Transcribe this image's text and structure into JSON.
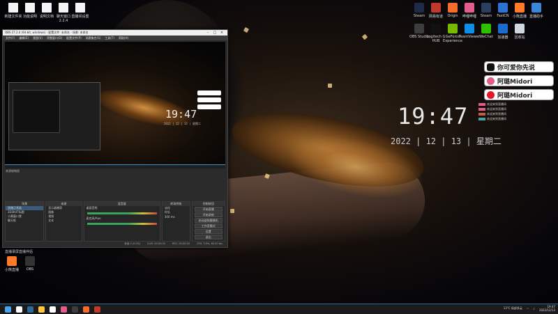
{
  "colors": {
    "accent": "#2d6a99",
    "obs_selected": "#3a5a7a",
    "meter_green": "#3ca55c"
  },
  "desktop": {
    "top_left_icons": [
      {
        "label": "新建文件夹",
        "kind": "file"
      },
      {
        "label": "功能说明",
        "kind": "file"
      },
      {
        "label": "说明文档",
        "kind": "file"
      },
      {
        "label": "聊天窗口 2.2.4",
        "kind": "file"
      },
      {
        "label": "直播间设置",
        "kind": "file"
      }
    ],
    "top_right_icons": [
      {
        "label": "Steam",
        "color": "#1e2a48"
      },
      {
        "label": "网易有道",
        "color": "#c0392b"
      },
      {
        "label": "Origin",
        "color": "#f56c2d"
      },
      {
        "label": "哔哩哔哩",
        "color": "#e35d8b"
      },
      {
        "label": "Steam",
        "color": "#2a3f5f"
      },
      {
        "label": "FastCN",
        "color": "#2b74d6"
      },
      {
        "label": "小熊直播",
        "color": "#ff7a29"
      },
      {
        "label": "直播助手",
        "color": "#3a86d8"
      },
      {
        "label": "OBS Studio",
        "color": "#3d3d3d"
      },
      {
        "label": "Logitech G HUB",
        "color": "#111111"
      },
      {
        "label": "GeForce Experience",
        "color": "#76b900"
      },
      {
        "label": "TeamViewer",
        "color": "#0e8ee9"
      },
      {
        "label": "WeChat",
        "color": "#2dc100"
      },
      {
        "label": "加速器",
        "color": "#1b6bd1"
      },
      {
        "label": "回收站",
        "color": "#cfd8e0"
      }
    ],
    "bottom_left_icons": [
      {
        "label": "小熊直播",
        "color": "#ff7a29"
      },
      {
        "label": "OBS",
        "color": "#333333"
      }
    ],
    "mid_left_icons": [
      {
        "label": "直播录屏",
        "color": "#222222"
      },
      {
        "label": "直播伴侣",
        "color": "#222222"
      }
    ]
  },
  "clock_widget": {
    "time": "19:47",
    "date": "2022 | 12 | 13 | 星期二"
  },
  "social_buttons": [
    {
      "label": "你可爱你先说",
      "platform": "tiktok-icon",
      "color": "#111111"
    },
    {
      "label": "阿璐Midori",
      "platform": "bilibili-icon",
      "color": "#e35d8b"
    },
    {
      "label": "阿璐Midori",
      "platform": "weibo-icon",
      "color": "#e6162d"
    }
  ],
  "chat": {
    "lines": [
      "欢迎来到直播间",
      "欢迎来到直播间",
      "欢迎来到直播间",
      "欢迎来到直播间"
    ]
  },
  "obs": {
    "title": "OBS 27.2.4 (64-bit, windows) - 配置文件: 未命名 - 场景: 未命名",
    "menu": [
      "文件(F)",
      "编辑(E)",
      "视图(V)",
      "停靠窗口(D)",
      "配置文件(P)",
      "场景集合(S)",
      "工具(T)",
      "帮助(H)"
    ],
    "preview": {
      "time": "19:47",
      "date": "2022 | 12 | 13 | 星期二"
    },
    "preview_label": "来源缩略图",
    "docks": {
      "scenes": {
        "header": "场景",
        "items": [
          "直播正常画",
          "2D3K4T标题",
          "小黄窗口素",
          "聊天框"
        ]
      },
      "sources": {
        "header": "来源",
        "items": [
          "显示器捕获",
          "图像",
          "视频",
          "文本"
        ]
      },
      "mixer": {
        "header": "混音器",
        "channels": [
          "桌面音频",
          "麦克风/Aux"
        ]
      },
      "transitions": {
        "header": "转场特效",
        "type": "淡化",
        "duration_label": "时长",
        "duration": "300 ms"
      },
      "controls": {
        "header": "控制按钮",
        "buttons": [
          "开始直播",
          "开始录制",
          "启动虚拟摄像机",
          "工作室模式",
          "设置",
          "退出"
        ]
      }
    },
    "status": {
      "dropped": "丢帧 0 (0.0%)",
      "live": "LIVE: 00:00:00",
      "rec": "REC: 00:00:00",
      "cpu": "CPU: 3.9%, 60.00 fps"
    }
  },
  "taskbar": {
    "weather": "13°C 局部多云",
    "time": "19:47",
    "date": "2022/12/13",
    "apps": [
      "#ffffff",
      "#2d6a99",
      "#ffc83d",
      "#ffffff",
      "#e35d8b",
      "#3d3d3d",
      "#f56c2d",
      "#c0392b"
    ]
  }
}
